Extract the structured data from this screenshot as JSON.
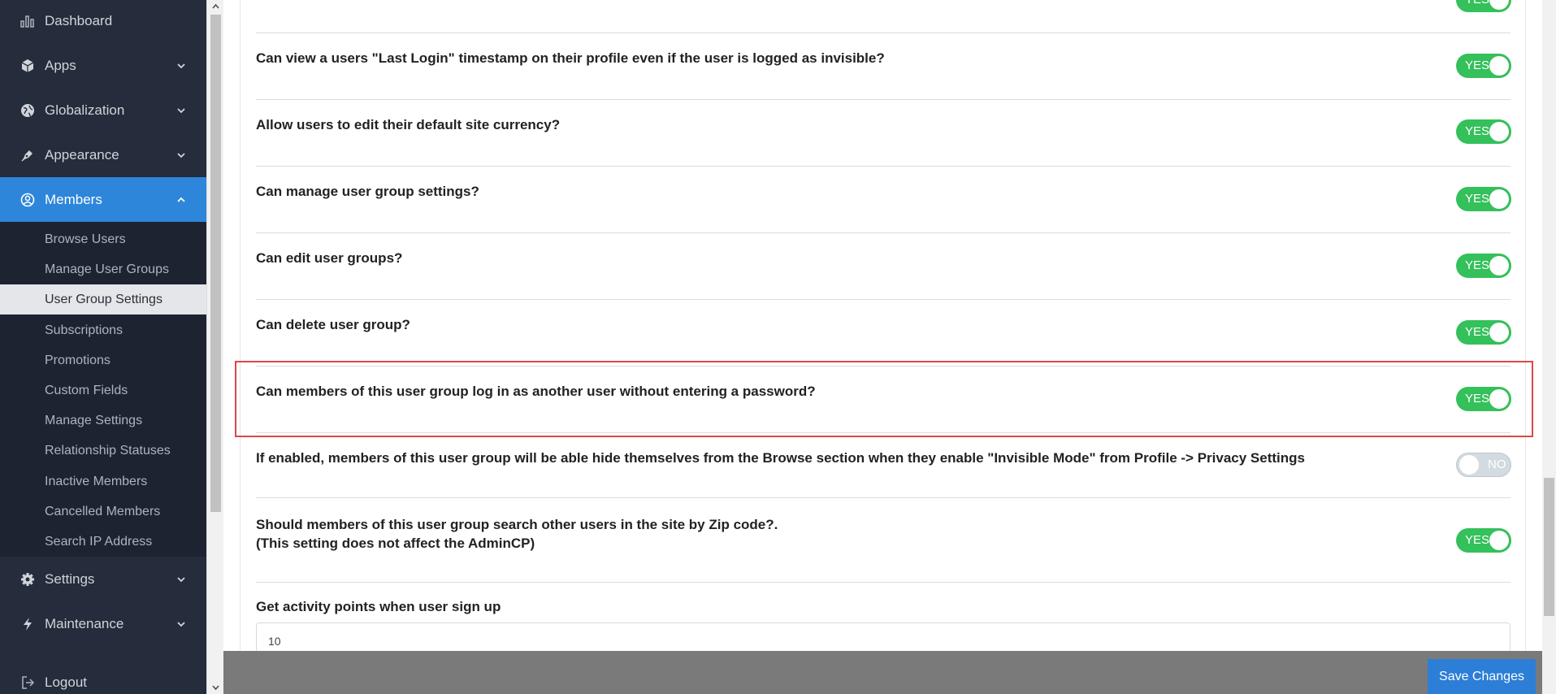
{
  "sidebar": {
    "items": [
      {
        "label": "Dashboard",
        "icon": "bar-chart-icon"
      },
      {
        "label": "Apps",
        "icon": "cube-icon"
      },
      {
        "label": "Globalization",
        "icon": "globe-icon"
      },
      {
        "label": "Appearance",
        "icon": "pen-icon"
      },
      {
        "label": "Members",
        "icon": "user-circle-icon"
      },
      {
        "label": "Settings",
        "icon": "gear-icon"
      },
      {
        "label": "Maintenance",
        "icon": "bolt-icon"
      },
      {
        "label": "Logout",
        "icon": "logout-icon"
      }
    ],
    "members_submenu": [
      "Browse Users",
      "Manage User Groups",
      "User Group Settings",
      "Subscriptions",
      "Promotions",
      "Custom Fields",
      "Manage Settings",
      "Relationship Statuses",
      "Inactive Members",
      "Cancelled Members",
      "Search IP Address"
    ]
  },
  "settings": [
    {
      "question": "Can view a users \"Last Login\" timestamp on their profile even if the user is logged as invisible?",
      "value": "YES"
    },
    {
      "question": "Allow users to edit their default site currency?",
      "value": "YES"
    },
    {
      "question": "Can manage user group settings?",
      "value": "YES"
    },
    {
      "question": "Can edit user groups?",
      "value": "YES"
    },
    {
      "question": "Can delete user group?",
      "value": "YES"
    },
    {
      "question": "Can members of this user group log in as another user without entering a password?",
      "value": "YES"
    },
    {
      "question": "If enabled, members of this user group will be able hide themselves from the Browse section when they enable \"Invisible Mode\" from Profile -> Privacy Settings",
      "value": "NO"
    },
    {
      "question": "Should members of this user group search other users in the site by Zip code?.",
      "question_line2": "(This setting does not affect the AdminCP)",
      "value": "YES"
    }
  ],
  "top_partial_toggle": "YES",
  "activity_points": {
    "label": "Get activity points when user sign up",
    "value": "10"
  },
  "footer": {
    "save_label": "Save Changes"
  },
  "colors": {
    "sidebar_bg": "#252c3b",
    "active_bg": "#2d86d9",
    "toggle_on": "#34c05a",
    "toggle_off": "#d3dbe0",
    "highlight": "#e04646",
    "save_button": "#2c7ed6"
  }
}
